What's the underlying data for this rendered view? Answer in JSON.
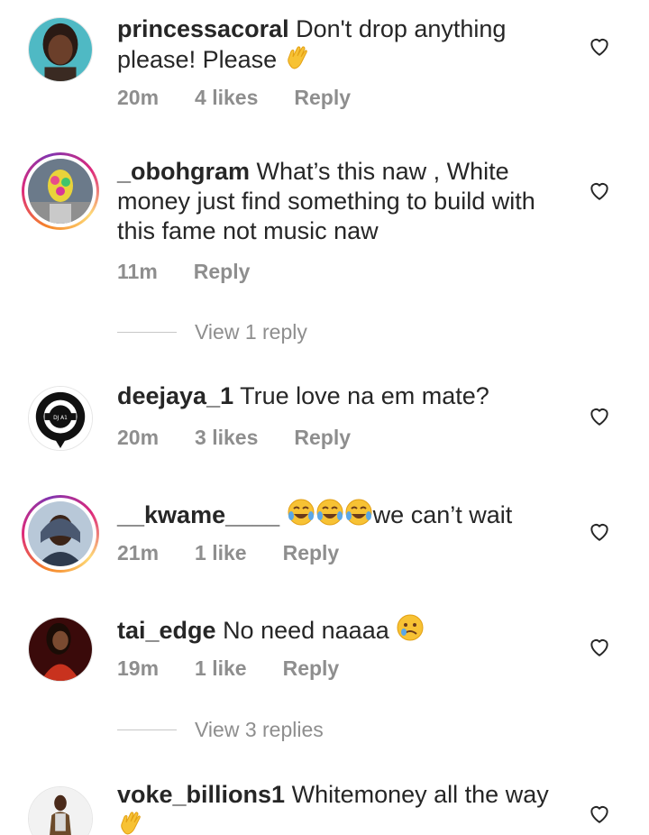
{
  "comments": [
    {
      "username": "princessacoral",
      "text": "Don't drop anything please! Please",
      "emoji": "waving-hand",
      "time": "20m",
      "likes": "4 likes",
      "reply": "Reply",
      "avatar": "profile-photo-woman-teal-background",
      "story_ring": false
    },
    {
      "username": "_obohgram",
      "text": "What’s this naw , White money just find something to build with this fame  not music naw",
      "time": "11m",
      "reply": "Reply",
      "avatar": "profile-photo-colorful-mask",
      "story_ring": true,
      "view_replies": "View 1 reply"
    },
    {
      "username": "deejaya_1",
      "text": "True love na em mate?",
      "time": "20m",
      "likes": "3 likes",
      "reply": "Reply",
      "avatar": "dj-logo-black-circle",
      "story_ring": false
    },
    {
      "username": "__kwame____",
      "text": "we can’t wait",
      "emoji": "tears-of-joy x3",
      "time": "21m",
      "likes": "1 like",
      "reply": "Reply",
      "avatar": "profile-photo-man-hooded-jacket",
      "story_ring": true
    },
    {
      "username": "tai_edge",
      "text": "No need naaaa",
      "emoji": "crying-face",
      "time": "19m",
      "likes": "1 like",
      "reply": "Reply",
      "avatar": "profile-photo-woman-red-dress",
      "story_ring": false,
      "view_replies": "View 3 replies"
    },
    {
      "username": "voke_billions1",
      "text": "Whitemoney all the way",
      "emoji": "waving-hand",
      "avatar": "profile-photo-person-standing",
      "story_ring": false
    }
  ],
  "colors": {
    "text": "#262626",
    "meta": "#8e8e8e",
    "story_ring_gradient": [
      "#f58529",
      "#dd2a7b",
      "#8134af"
    ]
  },
  "icons": {
    "like": "heart-outline-icon"
  }
}
